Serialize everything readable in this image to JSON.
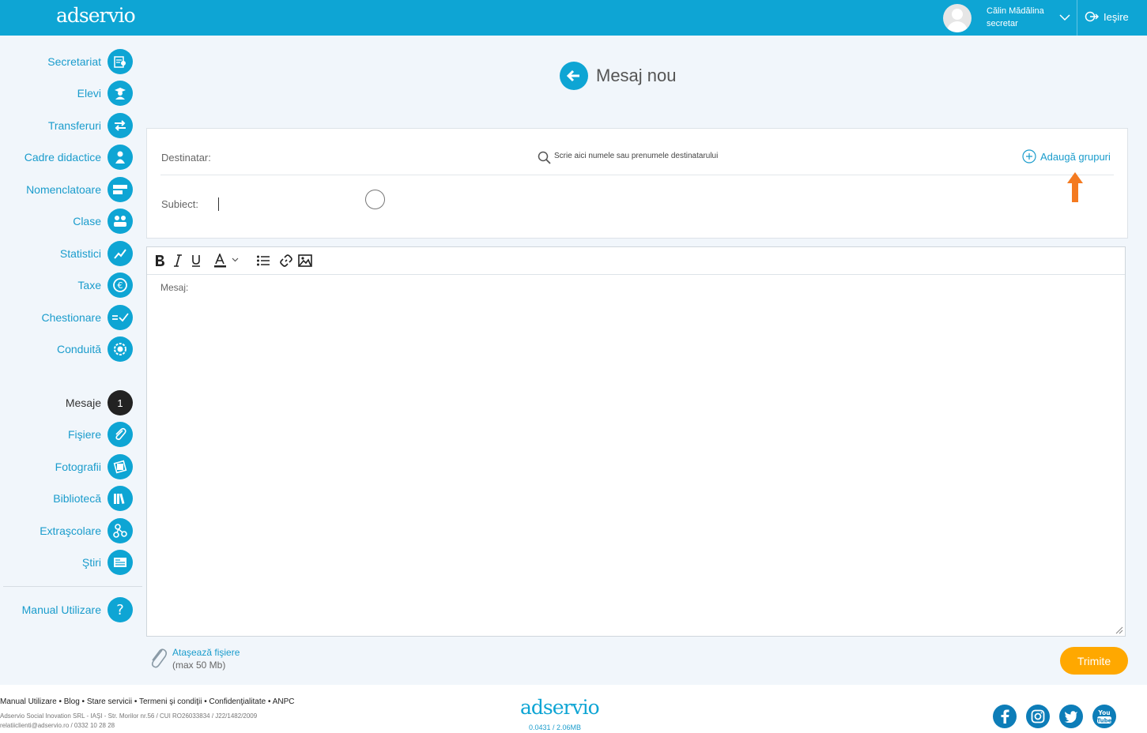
{
  "header": {
    "logo": "adservio",
    "user_name": "Călin Mădălina",
    "user_role": "secretar",
    "logout_label": "Ieşire"
  },
  "sidebar": {
    "items": [
      {
        "label": "Secretariat",
        "icon": "certificate-icon"
      },
      {
        "label": "Elevi",
        "icon": "graduate-icon"
      },
      {
        "label": "Transferuri",
        "icon": "transfer-arrows-icon"
      },
      {
        "label": "Cadre didactice",
        "icon": "teacher-icon"
      },
      {
        "label": "Nomenclatoare",
        "icon": "cards-icon"
      },
      {
        "label": "Clase",
        "icon": "class-group-icon"
      },
      {
        "label": "Statistici",
        "icon": "trend-chart-icon"
      },
      {
        "label": "Taxe",
        "icon": "euro-icon"
      },
      {
        "label": "Chestionare",
        "icon": "checklist-icon"
      },
      {
        "label": "Conduită",
        "icon": "badge-icon"
      },
      {
        "label": "Mesaje",
        "icon": "message-count-badge",
        "badge": "1"
      },
      {
        "label": "Fişiere",
        "icon": "paperclip-icon"
      },
      {
        "label": "Fotografii",
        "icon": "photo-icon"
      },
      {
        "label": "Bibliotecă",
        "icon": "books-icon"
      },
      {
        "label": "Extraşcolare",
        "icon": "activities-icon"
      },
      {
        "label": "Ştiri",
        "icon": "news-icon"
      },
      {
        "label": "Manual Utilizare",
        "icon": "question-icon"
      }
    ]
  },
  "page": {
    "title": "Mesaj nou"
  },
  "form": {
    "recipient_label": "Destinatar:",
    "recipient_placeholder": "Scrie aici numele sau prenumele destinatarului",
    "add_groups_label": "Adaugă grupuri",
    "subject_label": "Subiect:",
    "subject_value": ""
  },
  "editor": {
    "message_label": "Mesaj:",
    "toolbar": [
      "bold",
      "italic",
      "underline",
      "text-color",
      "bullet-list",
      "link",
      "image"
    ]
  },
  "actions": {
    "attach_label": "Ataşează fişiere",
    "attach_limit": "(max 50 Mb)",
    "send_label": "Trimite"
  },
  "footer": {
    "links": "Manual Utilizare • Blog • Stare servicii • Termeni şi condiţii • Confidenţialitate • ANPC",
    "company": "Adservio Social Inovation SRL - IAŞI - Str. Morilor nr.56 / CUI RO26033834 / J22/1482/2009",
    "contact": "relatiiclienti@adservio.ro / 0332 10 28 28",
    "logo": "adservio",
    "version": "0.0431 / 2.06MB"
  },
  "colors": {
    "brand": "#0ea5d4",
    "send_button": "#ffa800",
    "annotation_arrow": "#f47a20"
  }
}
